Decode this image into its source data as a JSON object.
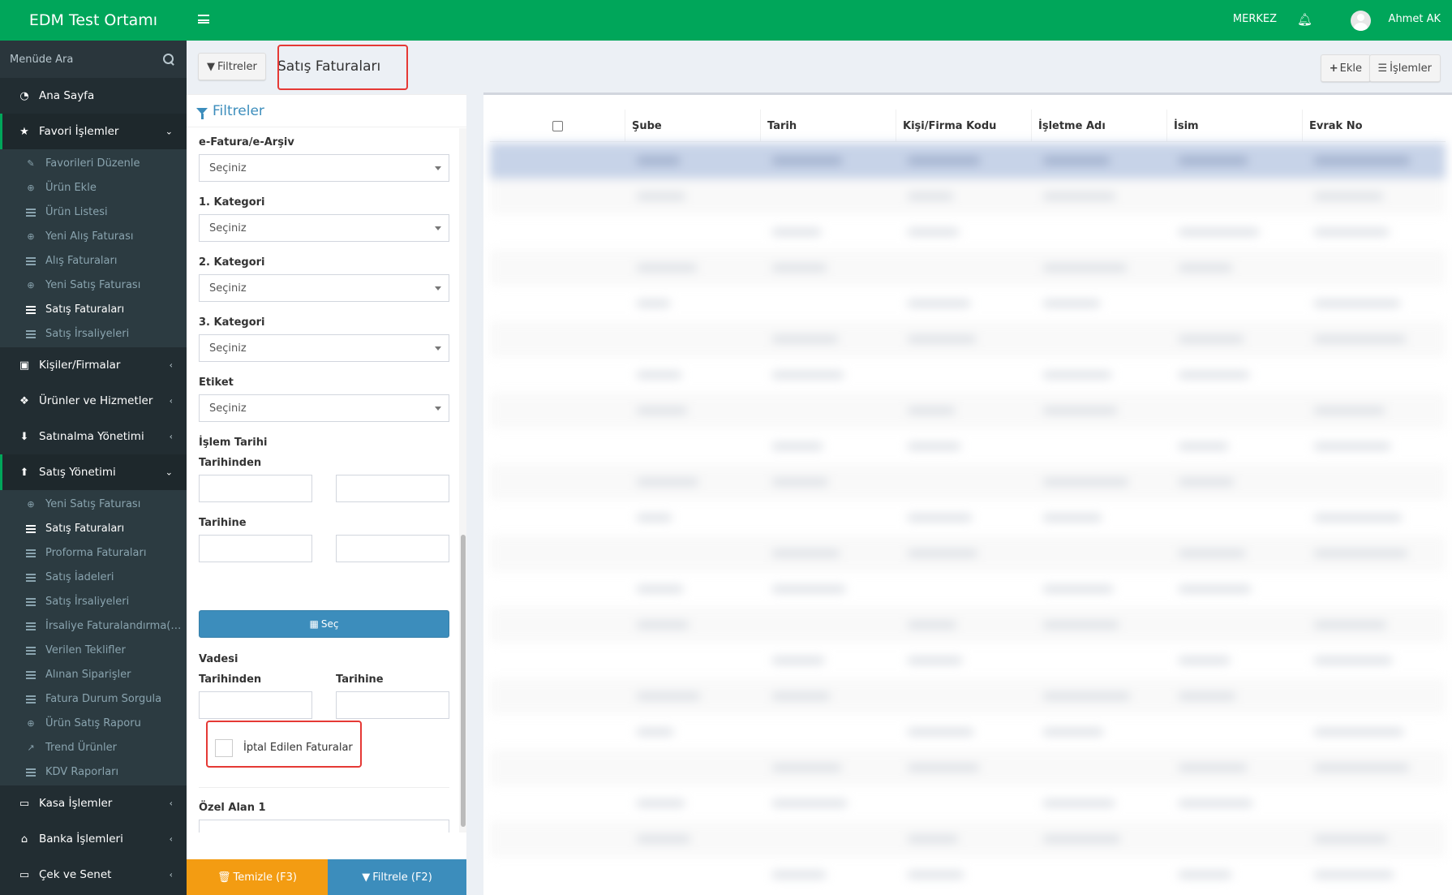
{
  "app": {
    "title": "EDM Test Ortamı"
  },
  "topbar": {
    "branch": "MERKEZ",
    "user": "Ahmet AK"
  },
  "sidebar": {
    "search_placeholder": "Menüde Ara",
    "home": "Ana Sayfa",
    "favorites": {
      "label": "Favori İşlemler",
      "items": [
        "Favorileri Düzenle",
        "Ürün Ekle",
        "Ürün Listesi",
        "Yeni Alış Faturası",
        "Alış Faturaları",
        "Yeni Satış Faturası",
        "Satış Faturaları",
        "Satış İrsaliyeleri"
      ]
    },
    "contacts": "Kişiler/Firmalar",
    "products": "Ürünler ve Hizmetler",
    "purchasing": "Satınalma Yönetimi",
    "sales": {
      "label": "Satış Yönetimi",
      "items": [
        "Yeni Satış Faturası",
        "Satış Faturaları",
        "Proforma Faturaları",
        "Satış İadeleri",
        "Satış İrsaliyeleri",
        "İrsaliye Faturalandırma(…",
        "Verilen Teklifler",
        "Alınan Siparişler",
        "Fatura Durum Sorgula",
        "Ürün Satış Raporu",
        "Trend Ürünler",
        "KDV Raporları"
      ]
    },
    "cash": "Kasa İşlemler",
    "bank": "Banka İşlemleri",
    "cheque": "Çek ve Senet"
  },
  "header": {
    "filters_button": "Filtreler",
    "title": "Satış Faturaları",
    "add_button": "Ekle",
    "operations_button": "İşlemler"
  },
  "filters": {
    "heading": "Filtreler",
    "einvoice_label": "e-Fatura/e-Arşiv",
    "cat1_label": "1. Kategori",
    "cat2_label": "2. Kategori",
    "cat3_label": "3. Kategori",
    "tag_label": "Etiket",
    "select_placeholder": "Seçiniz",
    "process_date_label": "İşlem Tarihi",
    "from_label": "Tarihinden",
    "to_label": "Tarihine",
    "pick_button": "Seç",
    "due_label": "Vadesi",
    "cancelled_label": "İptal Edilen Faturalar",
    "custom1_label": "Özel Alan 1",
    "clear_button": "Temizle (F3)",
    "apply_button": "Filtrele (F2)"
  },
  "table": {
    "columns": [
      "Şube",
      "Tarih",
      "Kişi/Firma Kodu",
      "İşletme Adı",
      "İsim",
      "Evrak No"
    ]
  },
  "colors": {
    "brand_green": "#00a65a",
    "sidebar_bg": "#222d32",
    "primary_blue": "#3c8dbc",
    "warning_orange": "#f39c12",
    "highlight_red": "#e53935"
  }
}
